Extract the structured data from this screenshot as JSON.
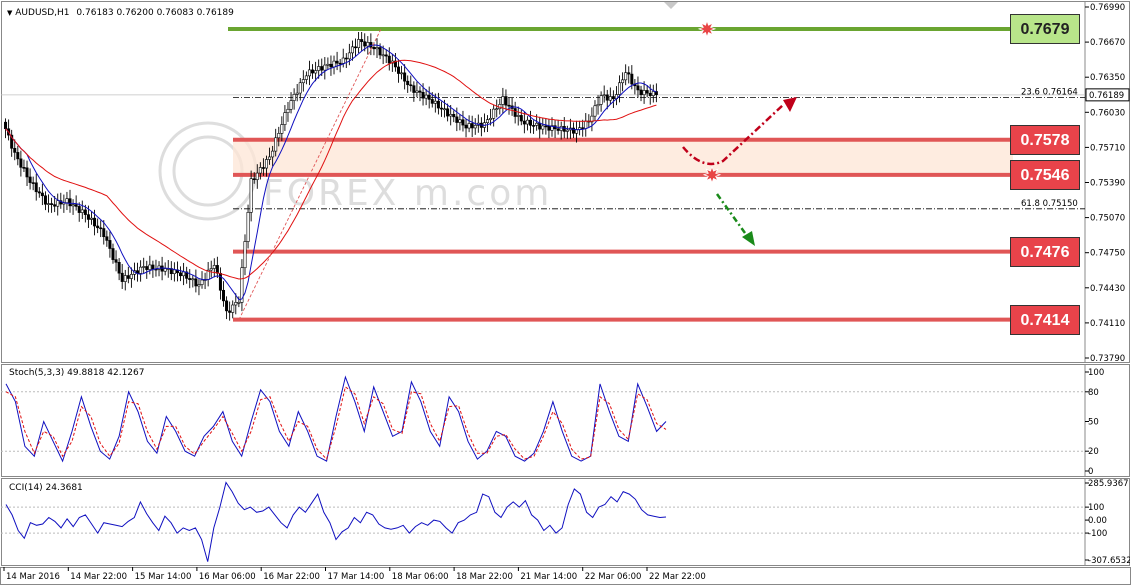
{
  "chart_header": {
    "symbol": "AUDUSD,H1",
    "ohlc": "0.76183 0.76200 0.76083 0.76189"
  },
  "watermark": "FOREX m.com",
  "colors": {
    "bull": "#000000",
    "bear": "#000000",
    "ma_fast": "#1010c0",
    "ma_slow": "#e01010",
    "resistance": "#6aa531",
    "support": "#e05656",
    "up_arrow": "#c0001a",
    "down_arrow": "#1a8a1a",
    "stoch_main": "#1010c0",
    "stoch_signal": "#e01010",
    "cci": "#1010c0"
  },
  "levels": [
    {
      "value": 0.7679,
      "label": "0.7679",
      "kind": "resistance",
      "box_fill": "#b8e58a"
    },
    {
      "value": 0.7578,
      "label": "0.7578",
      "kind": "support",
      "box_fill": "#e8434a"
    },
    {
      "value": 0.7546,
      "label": "0.7546",
      "kind": "support",
      "box_fill": "#e8434a"
    },
    {
      "value": 0.7476,
      "label": "0.7476",
      "kind": "support",
      "box_fill": "#e8434a"
    },
    {
      "value": 0.7414,
      "label": "0.7414",
      "kind": "support",
      "box_fill": "#e8434a"
    }
  ],
  "fib_labels": [
    {
      "value": 0.76164,
      "label": "23.6   0.76164"
    },
    {
      "value": 0.7515,
      "label": "61.8   0.75150"
    }
  ],
  "current_price": {
    "value": 0.76189,
    "label": "0.76189"
  },
  "stoch_label": "Stoch(5,3,3) 49.8818 42.1267",
  "cci_label": "CCI(14) 24.3681",
  "chart_data": [
    {
      "type": "candlestick",
      "title": "AUDUSD,H1",
      "ylim": [
        0.7379,
        0.7699
      ],
      "y_ticks": [
        "0.76990",
        "0.76670",
        "0.76350",
        "0.76030",
        "0.75710",
        "0.75390",
        "0.75070",
        "0.74750",
        "0.74430",
        "0.74110",
        "0.73790"
      ],
      "x_ticks": [
        "14 Mar 2016",
        "14 Mar 22:00",
        "15 Mar 14:00",
        "16 Mar 06:00",
        "16 Mar 22:00",
        "17 Mar 14:00",
        "18 Mar 06:00",
        "18 Mar 22:00",
        "21 Mar 14:00",
        "22 Mar 06:00",
        "22 Mar 22:00"
      ],
      "close_waypoints": [
        [
          0,
          0.7588
        ],
        [
          3,
          0.7565
        ],
        [
          8,
          0.754
        ],
        [
          14,
          0.7518
        ],
        [
          20,
          0.7522
        ],
        [
          26,
          0.751
        ],
        [
          32,
          0.7492
        ],
        [
          38,
          0.745
        ],
        [
          45,
          0.7462
        ],
        [
          52,
          0.746
        ],
        [
          58,
          0.7455
        ],
        [
          63,
          0.7445
        ],
        [
          68,
          0.7465
        ],
        [
          72,
          0.742
        ],
        [
          76,
          0.7432
        ],
        [
          80,
          0.754
        ],
        [
          86,
          0.7562
        ],
        [
          92,
          0.7608
        ],
        [
          98,
          0.7638
        ],
        [
          104,
          0.7645
        ],
        [
          110,
          0.765
        ],
        [
          115,
          0.7668
        ],
        [
          120,
          0.7662
        ],
        [
          126,
          0.7648
        ],
        [
          132,
          0.7625
        ],
        [
          138,
          0.7615
        ],
        [
          144,
          0.7602
        ],
        [
          150,
          0.759
        ],
        [
          156,
          0.7592
        ],
        [
          162,
          0.7615
        ],
        [
          168,
          0.7595
        ],
        [
          174,
          0.759
        ],
        [
          180,
          0.7588
        ],
        [
          186,
          0.7586
        ],
        [
          190,
          0.7595
        ],
        [
          194,
          0.7618
        ],
        [
          198,
          0.7615
        ],
        [
          202,
          0.764
        ],
        [
          206,
          0.7622
        ],
        [
          212,
          0.7619
        ]
      ],
      "ma_fast_period": 8,
      "ma_slow_period": 34
    },
    {
      "type": "line",
      "title": "Stoch(5,3,3) 49.8818 42.1267",
      "ylim": [
        0,
        100
      ],
      "y_ticks": [
        "100",
        "80",
        "50",
        "20",
        "0"
      ],
      "series": [
        {
          "name": "main",
          "values": [
            88,
            70,
            25,
            15,
            50,
            30,
            10,
            40,
            75,
            45,
            20,
            12,
            35,
            80,
            60,
            30,
            18,
            55,
            40,
            20,
            15,
            35,
            45,
            60,
            30,
            15,
            50,
            82,
            70,
            40,
            25,
            60,
            40,
            15,
            10,
            55,
            95,
            70,
            40,
            85,
            60,
            35,
            40,
            90,
            70,
            40,
            25,
            75,
            60,
            30,
            12,
            20,
            40,
            35,
            15,
            10,
            18,
            40,
            70,
            40,
            15,
            10,
            15,
            88,
            60,
            35,
            30,
            88,
            65,
            40,
            50
          ]
        },
        {
          "name": "signal",
          "values": [
            80,
            75,
            40,
            18,
            40,
            35,
            15,
            30,
            65,
            55,
            28,
            15,
            28,
            70,
            68,
            40,
            22,
            45,
            45,
            25,
            17,
            30,
            42,
            55,
            38,
            20,
            40,
            72,
            75,
            50,
            30,
            50,
            45,
            22,
            12,
            45,
            85,
            78,
            48,
            75,
            68,
            42,
            38,
            80,
            78,
            48,
            30,
            65,
            66,
            38,
            18,
            18,
            35,
            37,
            22,
            12,
            15,
            35,
            60,
            48,
            22,
            12,
            14,
            75,
            68,
            42,
            32,
            78,
            72,
            48,
            42
          ]
        }
      ]
    },
    {
      "type": "line",
      "title": "CCI(14) 24.3681",
      "ylim": [
        -307.6532,
        285.9367
      ],
      "y_ticks": [
        "285.9367",
        "100",
        "0.00",
        "-100",
        "-307.6532"
      ],
      "series": [
        {
          "name": "CCI(14)",
          "values": [
            120,
            40,
            -80,
            -140,
            -20,
            -40,
            -30,
            20,
            -10,
            -60,
            10,
            -50,
            20,
            40,
            -30,
            -100,
            -20,
            -30,
            -40,
            -50,
            -10,
            20,
            140,
            50,
            -20,
            -80,
            30,
            -20,
            -100,
            -60,
            -80,
            -60,
            -150,
            -320,
            -60,
            100,
            290,
            220,
            130,
            80,
            100,
            60,
            70,
            100,
            40,
            -20,
            -60,
            40,
            100,
            60,
            130,
            200,
            60,
            -20,
            -150,
            -90,
            -60,
            20,
            -20,
            60,
            40,
            -30,
            -60,
            -70,
            -60,
            -40,
            -100,
            -50,
            -20,
            -40,
            0,
            -10,
            -60,
            -100,
            -20,
            0,
            40,
            60,
            200,
            180,
            60,
            20,
            100,
            140,
            100,
            150,
            40,
            0,
            -80,
            -40,
            -100,
            -60,
            120,
            240,
            200,
            60,
            20,
            100,
            120,
            180,
            140,
            220,
            200,
            160,
            80,
            40,
            30,
            20,
            24
          ]
        }
      ]
    }
  ]
}
